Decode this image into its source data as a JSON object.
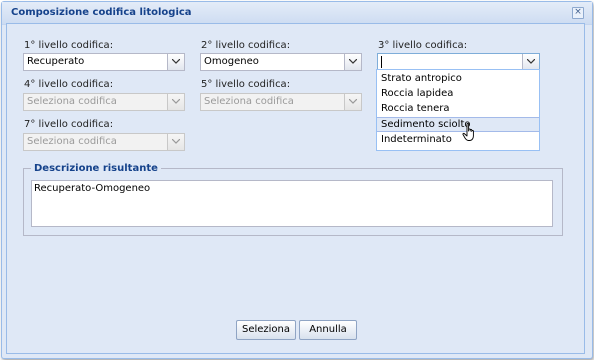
{
  "window": {
    "title": "Composizione codifica litologica",
    "close_symbol": "×"
  },
  "fields": {
    "level1": {
      "label": "1° livello codifica:",
      "value": "Recuperato"
    },
    "level2": {
      "label": "2° livello codifica:",
      "value": "Omogeneo"
    },
    "level3": {
      "label": "3° livello codifica:",
      "value": ""
    },
    "level4": {
      "label": "4° livello codifica:",
      "placeholder": "Seleziona codifica"
    },
    "level5": {
      "label": "5° livello codifica:",
      "placeholder": "Seleziona codifica"
    },
    "level7": {
      "label": "7° livello codifica:",
      "placeholder": "Seleziona codifica"
    }
  },
  "dropdown": {
    "options": [
      "Strato antropico",
      "Roccia lapidea",
      "Roccia tenera",
      "Sedimento sciolto",
      "Indeterminato"
    ],
    "hovered": "Sedimento sciolto"
  },
  "description": {
    "legend": "Descrizione risultante",
    "value": "Recuperato-Omogeneo"
  },
  "buttons": {
    "select": "Seleziona",
    "cancel": "Annulla"
  },
  "colors": {
    "title_text": "#15428b",
    "panel_bg": "#dfe8f6",
    "border": "#99bbe8"
  }
}
